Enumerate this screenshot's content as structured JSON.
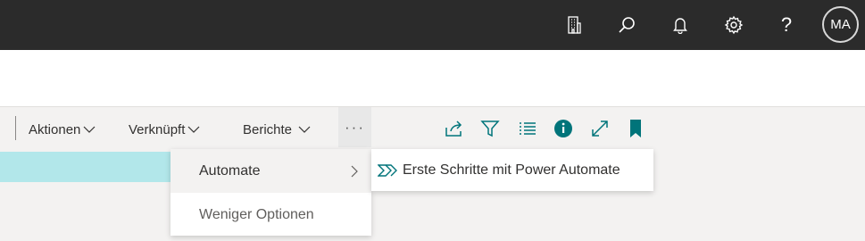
{
  "topbar": {
    "icons": [
      "company-icon",
      "search-icon",
      "bell-icon",
      "settings-icon",
      "help-icon"
    ],
    "help_glyph": "?",
    "avatar_initials": "MA"
  },
  "actionbar": {
    "menus": [
      {
        "label": "Aktionen"
      },
      {
        "label": "Verknüpft"
      },
      {
        "label": "Berichte"
      }
    ],
    "more_label": "···",
    "tool_icons": [
      "share-icon",
      "filter-icon",
      "list-view-icon",
      "info-icon",
      "expand-icon",
      "bookmark-icon"
    ]
  },
  "dropdown": {
    "items": [
      {
        "label": "Automate",
        "has_submenu": true,
        "highlighted": true
      },
      {
        "label": "Weniger Optionen",
        "has_submenu": false,
        "highlighted": false
      }
    ]
  },
  "submenu": {
    "items": [
      {
        "label": "Erste Schritte mit Power Automate",
        "icon": "power-automate-icon"
      }
    ]
  },
  "colors": {
    "topbar_bg": "#2b2b2b",
    "accent_teal": "#00747a",
    "selection_band": "#b2e7ea",
    "page_bg": "#f3f2f1"
  }
}
